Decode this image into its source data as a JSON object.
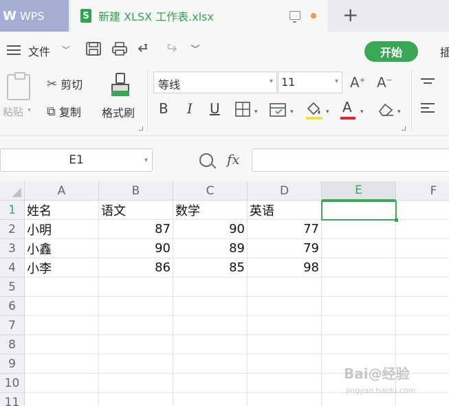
{
  "titlebar": {
    "app_label": "WPS",
    "doc_icon": "S",
    "doc_title": "新建 XLSX 工作表.xlsx"
  },
  "menu": {
    "file_label": "文件",
    "start_label": "开始",
    "insert_partial": "插"
  },
  "ribbon": {
    "paste_label": "粘贴",
    "cut_label": "剪切",
    "copy_label": "复制",
    "format_painter_label": "格式刷",
    "font_name": "等线",
    "font_size": "11",
    "bold": "B",
    "italic": "I",
    "underline": "U",
    "font_color_glyph": "A"
  },
  "formula_bar": {
    "name_box": "E1",
    "fx_label": "fx",
    "formula_value": ""
  },
  "sheet": {
    "columns": [
      "A",
      "B",
      "C",
      "D",
      "E",
      "F"
    ],
    "rows": [
      "1",
      "2",
      "3",
      "4",
      "5",
      "6",
      "7",
      "8",
      "9",
      "10",
      "11"
    ],
    "selected_cell": "E1",
    "cells": [
      [
        "姓名",
        "语文",
        "数学",
        "英语",
        "",
        ""
      ],
      [
        "小明",
        "87",
        "90",
        "77",
        "",
        ""
      ],
      [
        "小鑫",
        "90",
        "89",
        "79",
        "",
        ""
      ],
      [
        "小李",
        "86",
        "85",
        "98",
        "",
        ""
      ]
    ]
  },
  "watermark": {
    "text": "Bai@经验",
    "sub": "jingyan.baidu.com"
  },
  "colors": {
    "accent": "#3aa757",
    "wps_tab": "#a4aed4"
  }
}
